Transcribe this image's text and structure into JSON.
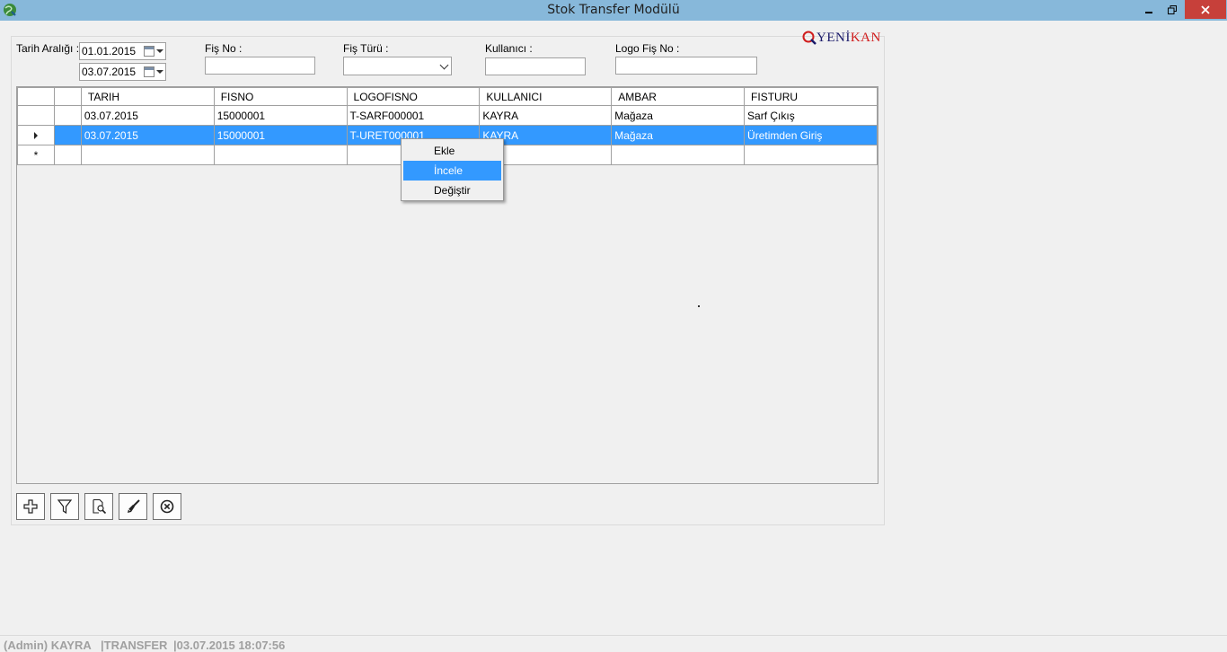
{
  "window": {
    "title": "Stok Transfer Modülü",
    "icon": "app-globe-icon"
  },
  "filters": {
    "date_range_label": "Tarih Aralığı :",
    "date_from": "01.01.2015",
    "date_to": "03.07.2015",
    "fis_no_label": "Fiş No :",
    "fis_no_value": "",
    "fis_turu_label": "Fiş Türü :",
    "fis_turu_value": "",
    "kullanici_label": "Kullanıcı :",
    "kullanici_value": "",
    "logo_fis_no_label": "Logo Fiş No :",
    "logo_fis_no_value": ""
  },
  "logo": {
    "part1": "YENİ",
    "part2": "KAN"
  },
  "grid": {
    "columns": [
      "TARIH",
      "FISNO",
      "LOGOFISNO",
      "KULLANICI",
      "AMBAR",
      "FISTURU"
    ],
    "rows": [
      [
        "03.07.2015",
        "15000001",
        "T-SARF000001",
        "KAYRA",
        "Mağaza",
        "Sarf Çıkış"
      ],
      [
        "03.07.2015",
        "15000001",
        "T-URET000001",
        "KAYRA",
        "Mağaza",
        "Üretimden Giriş"
      ]
    ],
    "new_row_marker": "*"
  },
  "context_menu": {
    "items": [
      "Ekle",
      "İncele",
      "Değiştir"
    ],
    "highlighted_index": 1
  },
  "toolbar": {
    "buttons": [
      "add-icon",
      "filter-icon",
      "preview-icon",
      "brush-icon",
      "close-circle-icon"
    ]
  },
  "status_bar": {
    "user": "(Admin) KAYRA",
    "module": "|TRANSFER",
    "datetime": "|03.07.2015 18:07:56"
  },
  "colors": {
    "titlebar": "#87b8da",
    "selection": "#3399ff",
    "close_button": "#c7403a",
    "logo_dark": "#1a1a6a",
    "logo_red": "#d01c1c"
  }
}
